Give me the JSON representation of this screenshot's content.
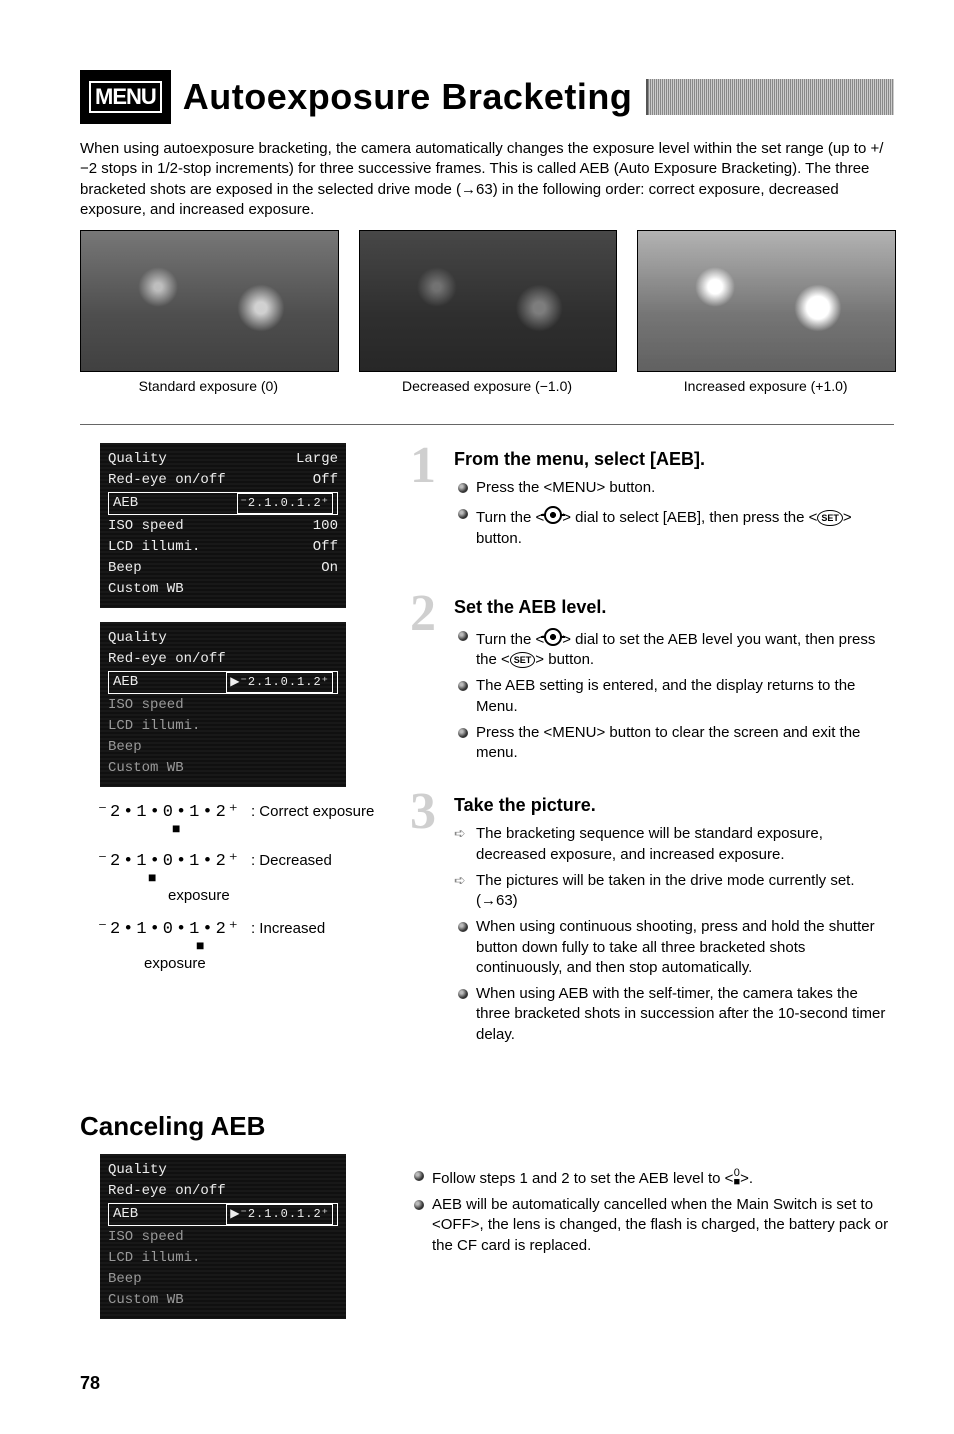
{
  "header": {
    "menu_badge": "MENU",
    "title": "Autoexposure Bracketing"
  },
  "intro": "When using autoexposure bracketing, the camera automatically changes the exposure level within the set range (up to +/−2 stops in 1/2-stop increments) for three successive frames. This is called AEB (Auto Exposure Bracketing). The three bracketed shots are exposed in the selected drive mode (→63) in the following order: correct exposure, decreased exposure, and increased exposure.",
  "figures": {
    "a": "Standard exposure (0)",
    "b": "Decreased exposure (−1.0)",
    "c": "Increased exposure (+1.0)"
  },
  "lcd1": {
    "quality": {
      "label": "Quality",
      "value": "Large"
    },
    "redeye": {
      "label": "Red-eye on/off",
      "value": "Off"
    },
    "aeb": {
      "label": "AEB",
      "value": "⁻2.1.0.1.2⁺"
    },
    "iso": {
      "label": "ISO speed",
      "value": "100"
    },
    "lcd": {
      "label": "LCD illumi.",
      "value": "Off"
    },
    "beep": {
      "label": "Beep",
      "value": "On"
    },
    "cwb": {
      "label": "Custom WB",
      "value": ""
    }
  },
  "lcd2": {
    "quality": {
      "label": "Quality",
      "value": ""
    },
    "redeye": {
      "label": "Red-eye on/off",
      "value": ""
    },
    "aeb": {
      "label": "AEB",
      "value": "▶⁻2.1.0.1.2⁺"
    },
    "iso": {
      "label": "ISO speed",
      "value": ""
    },
    "lcd": {
      "label": "LCD illumi.",
      "value": ""
    },
    "beep": {
      "label": "Beep",
      "value": ""
    },
    "cwb": {
      "label": "Custom WB",
      "value": ""
    }
  },
  "scales": {
    "correct": {
      "graphic": "⁻2•1•0•1•2⁺",
      "label": ": Correct exposure"
    },
    "decreased": {
      "graphic": "⁻2•1•0•1•2⁺",
      "label": ": Decreased",
      "label2": "exposure"
    },
    "increased": {
      "graphic": "⁻2•1•0•1•2⁺",
      "label": ": Increased",
      "label2": "exposure"
    }
  },
  "steps": {
    "s1": {
      "num": "1",
      "title": "From the menu, select [AEB].",
      "b1": "Press the <MENU> button.",
      "b2a": "Turn the <",
      "b2b": "> dial to select [AEB], then press the <",
      "b2c": "> button."
    },
    "s2": {
      "num": "2",
      "title": "Set the AEB level.",
      "b1a": "Turn the <",
      "b1b": "> dial to set the AEB level you want, then press the <",
      "b1c": "> button.",
      "b2": "The AEB setting is entered, and the display returns to the Menu.",
      "b3": "Press the <MENU> button to clear the screen and exit the menu."
    },
    "s3": {
      "num": "3",
      "title": "Take the picture.",
      "b1": "The bracketing sequence will be standard exposure, decreased exposure, and increased exposure.",
      "b2": "The pictures will be taken in the drive mode currently set. (→63)",
      "b3": "When using continuous shooting, press and hold the shutter button down fully to take all three bracketed shots continuously, and then stop automatically.",
      "b4": "When using AEB with the self-timer, the camera takes the three bracketed shots in succession after the 10-second timer delay."
    }
  },
  "cancel": {
    "title": "Canceling AEB",
    "lcd": {
      "quality": {
        "label": "Quality",
        "value": ""
      },
      "redeye": {
        "label": "Red-eye on/off",
        "value": ""
      },
      "aeb": {
        "label": "AEB",
        "value": "▶⁻2.1.0.1.2⁺"
      },
      "iso": {
        "label": "ISO speed",
        "value": ""
      },
      "lcd": {
        "label": "LCD illumi.",
        "value": ""
      },
      "beep": {
        "label": "Beep",
        "value": ""
      },
      "cwb": {
        "label": "Custom WB",
        "value": ""
      }
    },
    "b1a": "Follow steps 1 and 2 to set the AEB level to <",
    "b1b": ">.",
    "b2": "AEB will be automatically cancelled when the Main Switch is set to <OFF>, the lens is changed, the flash is charged, the battery pack or the CF card is replaced."
  },
  "page_number": "78"
}
